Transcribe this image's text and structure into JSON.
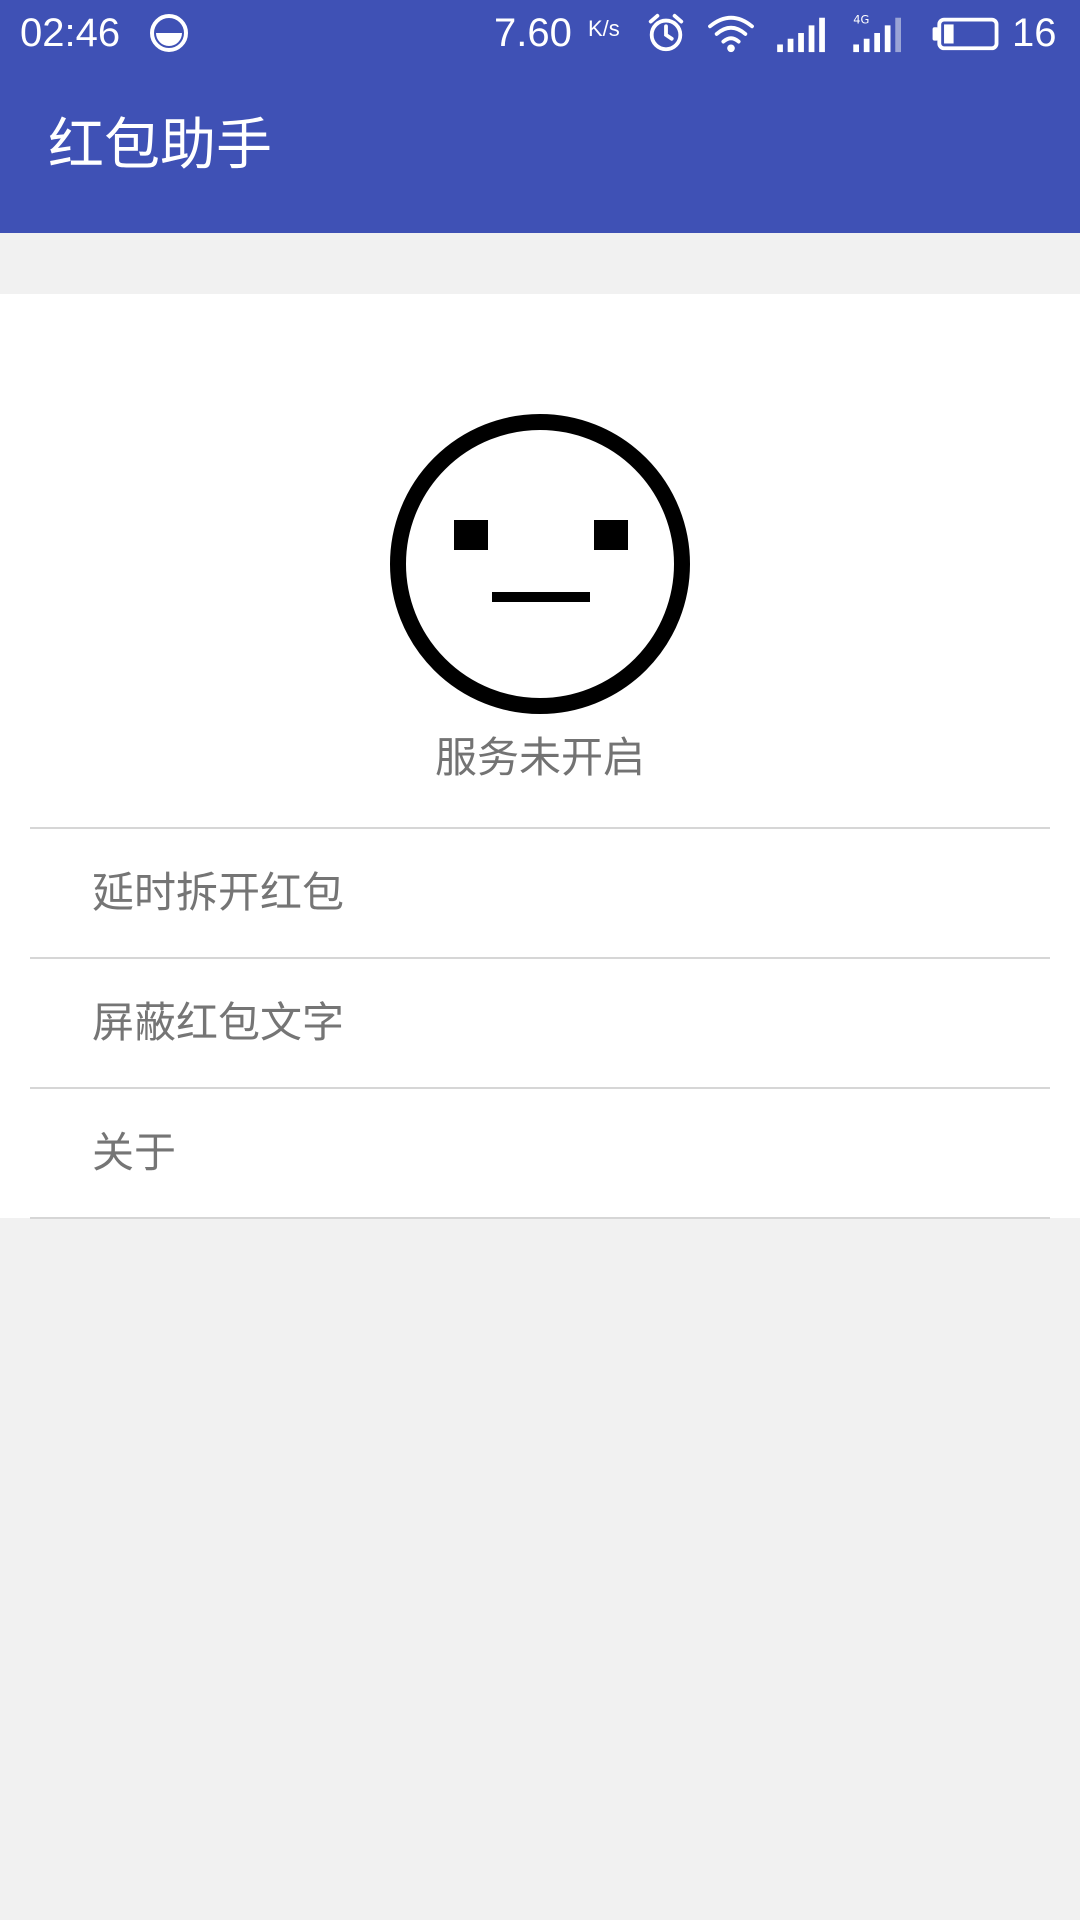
{
  "status_bar": {
    "time": "02:46",
    "net_speed": "7.60",
    "net_speed_unit": "K/s",
    "battery_level": "16",
    "icons": [
      "app-notification-icon",
      "alarm-icon",
      "wifi-icon",
      "signal-icon",
      "4g-signal-icon",
      "battery-icon"
    ],
    "network_badge": "4G"
  },
  "app_bar": {
    "title": "红包助手",
    "color": "#3f51b5"
  },
  "main": {
    "status_icon": "neutral-face-icon",
    "status_text": "服务未开启",
    "menu_items": [
      {
        "label": "延时拆开红包"
      },
      {
        "label": "屏蔽红包文字"
      },
      {
        "label": "关于"
      }
    ]
  }
}
